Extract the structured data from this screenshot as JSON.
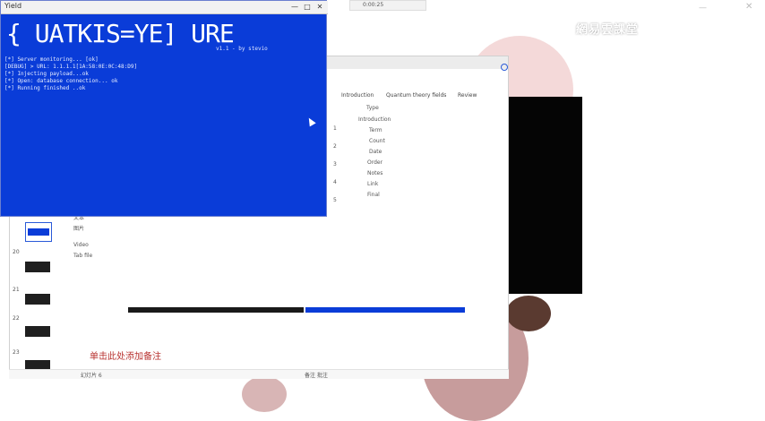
{
  "top_browser": {
    "tab_title": "0:00:25"
  },
  "watermark": {
    "text": "網易雲課堂"
  },
  "console": {
    "title": "Yield",
    "banner": "{ UATKIS=YE] URE",
    "banner_sub": "v1.1 - by stevio",
    "log_lines": [
      "[*] Server monitoring... [ok]",
      "[DEBUG] > URL: 1.1.1.1[1A:58:0E:0C:48:D9]",
      "[*] Injecting payload...ok",
      "[*] Open: database connection... ok",
      "[*] Running finished ..ok"
    ]
  },
  "document": {
    "tabs": [
      "Introduction",
      "Quantum theory fields",
      "Review"
    ],
    "column_label": "Type",
    "rows": [
      "Introduction",
      "Term",
      "Count",
      "Date",
      "Order",
      "Notes",
      "Link",
      "Final"
    ],
    "row_numbers": [
      "1",
      "2",
      "3",
      "4",
      "5"
    ],
    "sidebar_items": [
      "20",
      "21",
      "22",
      "23"
    ],
    "list_items": [
      "文本",
      "图片",
      "Video",
      "Tab file"
    ],
    "note_text": "单击此处添加备注",
    "statusbar_left": "幻灯片 6",
    "statusbar_right": "备注 批注"
  },
  "colors": {
    "console_bg": "#0a3cd8",
    "note_red": "#b8322f",
    "progress_blue": "#0a3cd8"
  }
}
